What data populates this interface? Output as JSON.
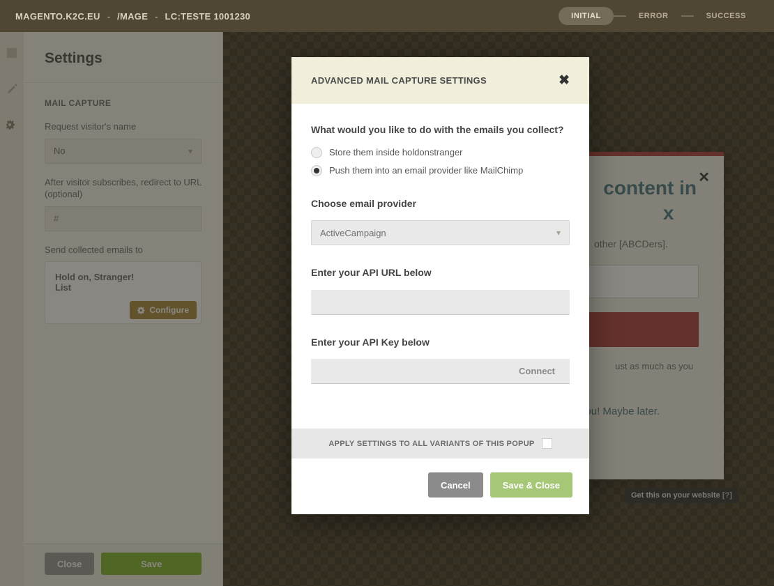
{
  "topbar": {
    "crumb1": "MAGENTO.K2C.EU",
    "crumb2": "/MAGE",
    "crumb3": "LC:TESTE 1001230",
    "pills": {
      "initial": "INITIAL",
      "error": "ERROR",
      "success": "SUCCESS"
    }
  },
  "settings": {
    "title": "Settings",
    "section": "MAIL CAPTURE",
    "request_name_label": "Request visitor's name",
    "request_name_value": "No",
    "redirect_label": "After visitor subscribes, redirect to URL (optional)",
    "redirect_value": "#",
    "send_to_label": "Send collected emails to",
    "service_line1": "Hold on, Stranger!",
    "service_line2": "List",
    "configure": "Configure",
    "close": "Close",
    "save": "Save"
  },
  "preview": {
    "headline_tail": "content in",
    "headline_tail2": "x",
    "sub_tail": "other [ABCDers].",
    "fine_tail": "ust as much as you do.",
    "decline_tail": "nk you! Maybe later."
  },
  "website_badge": {
    "text": "Get this on your website",
    "q": "[?]"
  },
  "modal": {
    "title": "ADVANCED MAIL CAPTURE SETTINGS",
    "question": "What would you like to do with the emails you collect?",
    "opt_store": "Store them inside holdonstranger",
    "opt_push": "Push them into an email provider like MailChimp",
    "choose_provider_label": "Choose email provider",
    "provider_value": "ActiveCampaign",
    "api_url_label": "Enter your API URL below",
    "api_key_label": "Enter your API Key below",
    "connect": "Connect",
    "apply_all": "APPLY SETTINGS TO ALL VARIANTS OF THIS POPUP",
    "cancel": "Cancel",
    "save_close": "Save & Close"
  }
}
